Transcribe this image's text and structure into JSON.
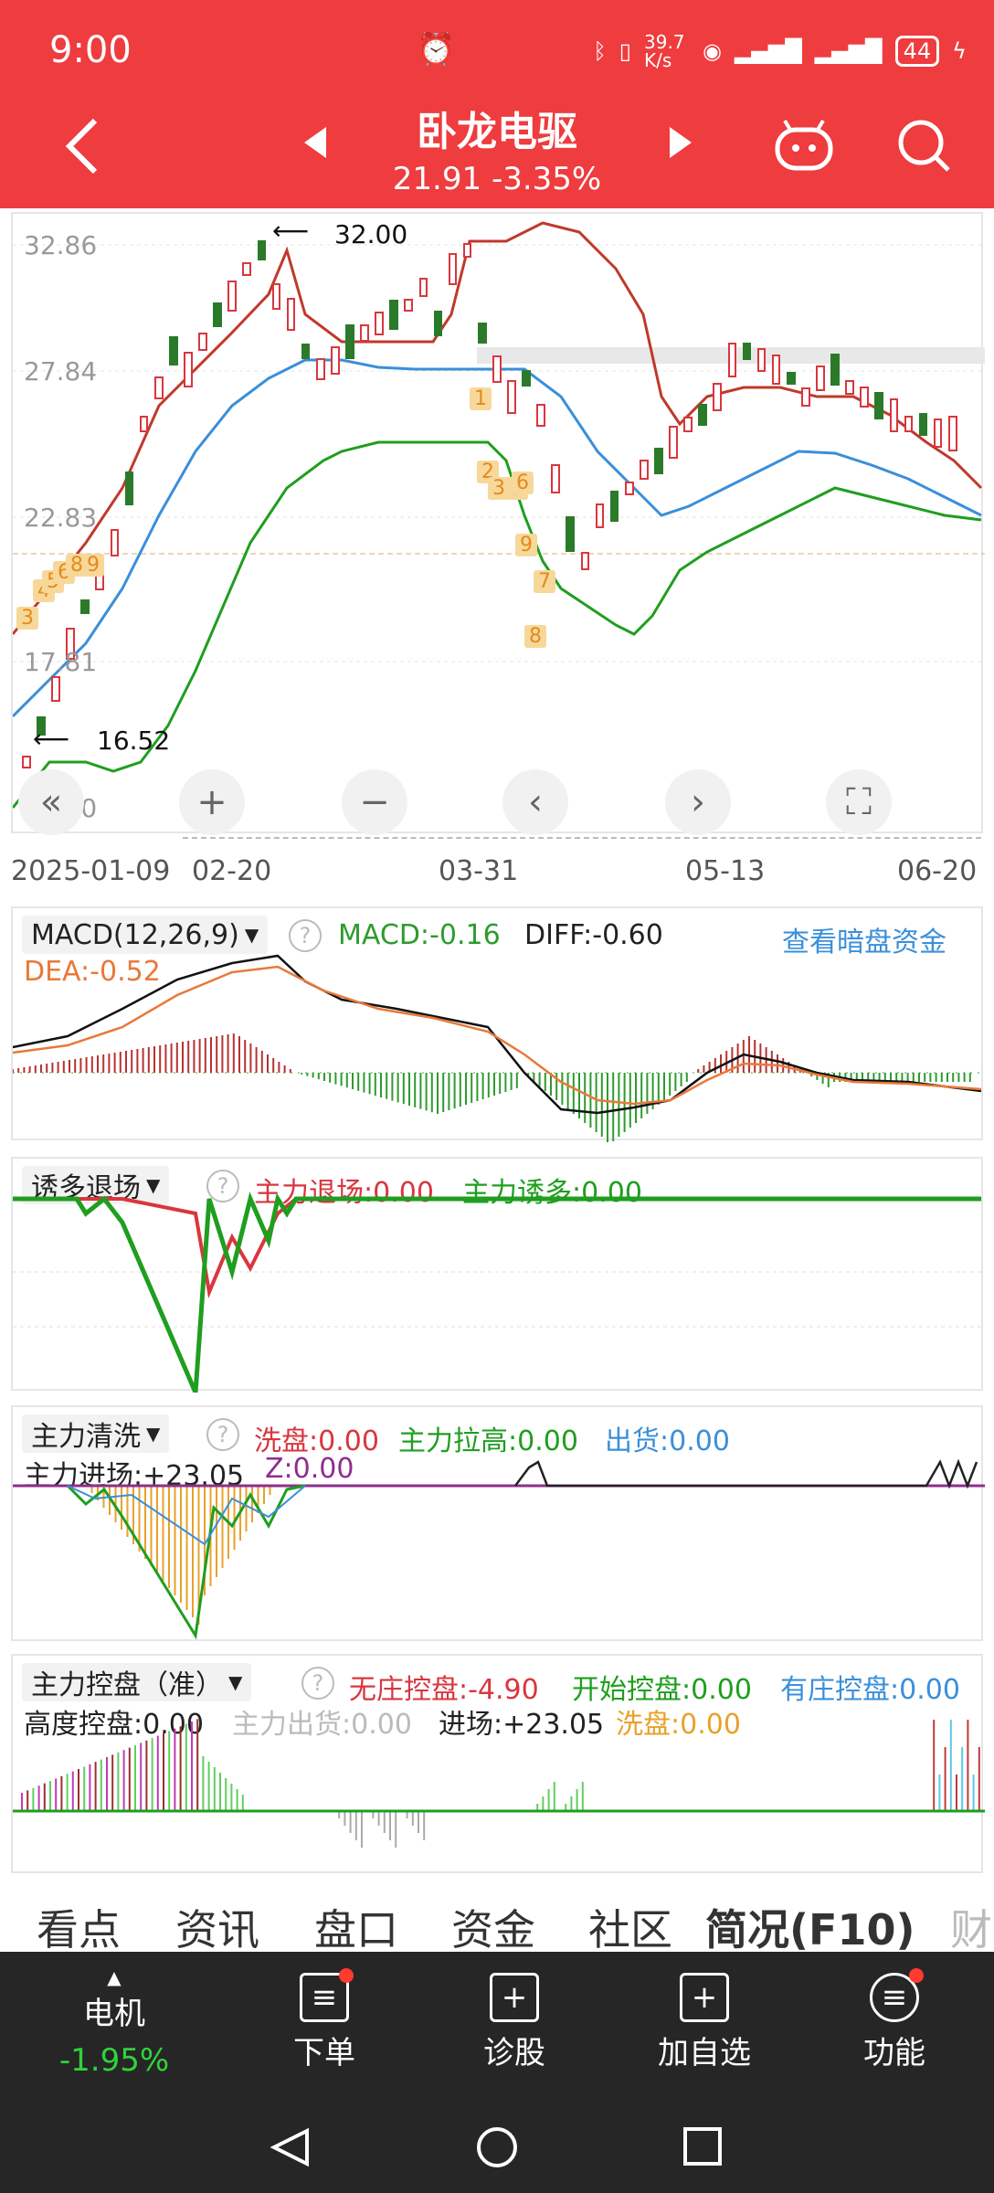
{
  "status_bar": {
    "time": "9:00",
    "net_speed": "39.7 K/s",
    "battery": "44"
  },
  "header": {
    "title": "卧龙电驱",
    "price": "21.91",
    "change": "-3.35%",
    "colors": {
      "bg": "#ee3c3f"
    }
  },
  "kline": {
    "price_labels": [
      "32.86",
      "27.84",
      "22.83",
      "17.81",
      "12.80"
    ],
    "high_note": "32.00",
    "low_note": "16.52",
    "dates": [
      "2025-01-09",
      "02-20",
      "03-31",
      "05-13",
      "06-20"
    ],
    "sequence_marks": [
      "3",
      "4",
      "5",
      "6",
      "8",
      "9",
      "1",
      "2",
      "3",
      "5",
      "6",
      "9",
      "7",
      "8"
    ]
  },
  "macd": {
    "selector": "MACD(12,26,9)",
    "macd": "MACD:-0.16",
    "diff": "DIFF:-0.60",
    "dea": "DEA:-0.52",
    "link": "查看暗盘资金"
  },
  "panel_exit": {
    "selector": "诱多退场",
    "exit": "主力退场:0.00",
    "lure": "主力诱多:0.00"
  },
  "panel_wash": {
    "selector": "主力清洗",
    "wash": "洗盘:0.00",
    "pull": "主力拉高:0.00",
    "ship": "出货:0.00",
    "enter": "主力进场:+23.05",
    "z": "Z:0.00"
  },
  "panel_control": {
    "selector": "主力控盘（准）",
    "none": "无庄控盘:-4.90",
    "start": "开始控盘:0.00",
    "has": "有庄控盘:0.00",
    "high": "高度控盘:0.00",
    "out": "主力出货:0.00",
    "enter": "进场:+23.05",
    "wash": "洗盘:0.00"
  },
  "tabs": [
    "看点",
    "资讯",
    "盘口",
    "资金",
    "社区",
    "简况(F10)",
    "财"
  ],
  "toolbar": {
    "stock_label": "电机",
    "stock_change": "-1.95%",
    "order": "下单",
    "diagnose": "诊股",
    "add": "加自选",
    "func": "功能"
  }
}
